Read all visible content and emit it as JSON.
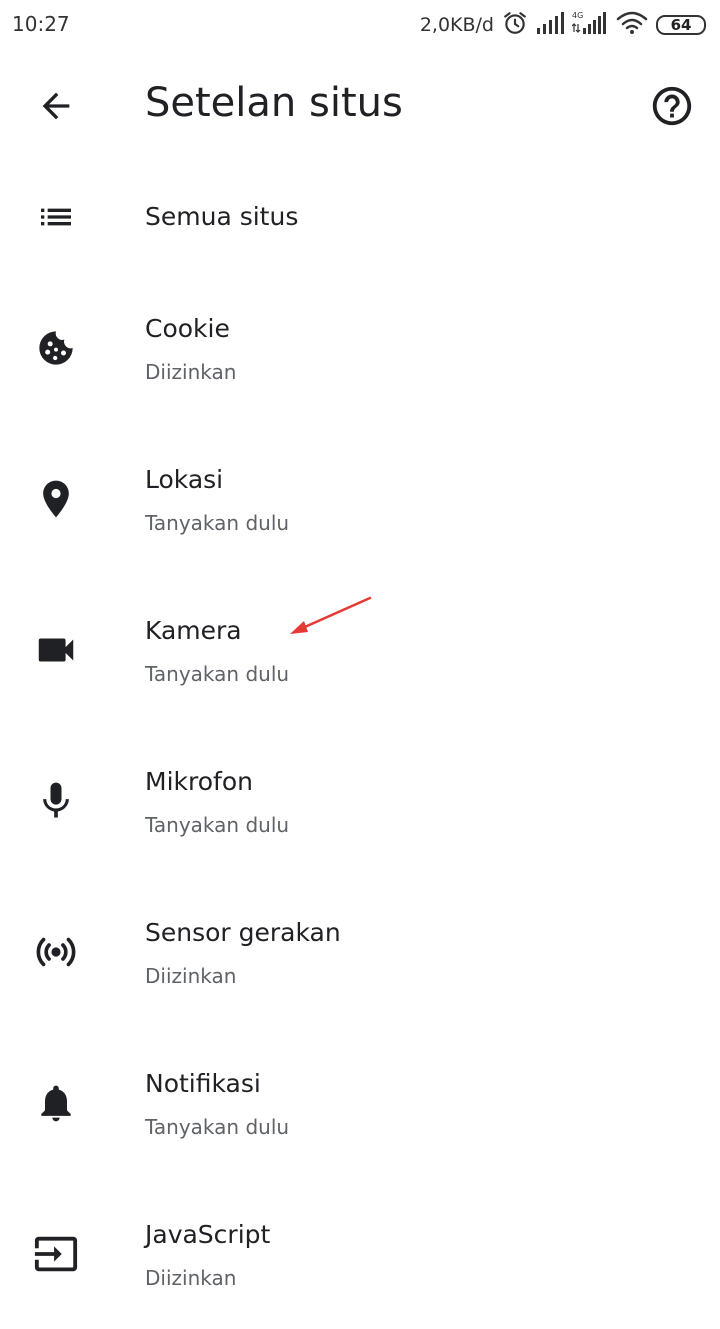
{
  "status_bar": {
    "time": "10:27",
    "net_speed": "2,0KB/d",
    "network_type": "4G",
    "battery_level": "64",
    "icons": [
      "alarm-icon",
      "signal-icon",
      "signal-4g-icon",
      "wifi-icon",
      "battery-icon"
    ]
  },
  "toolbar": {
    "title": "Setelan situs",
    "back_icon": "arrow-back-icon",
    "help_icon": "help-icon"
  },
  "items": [
    {
      "title": "Semua situs",
      "subtitle": "",
      "icon": "list-icon"
    },
    {
      "title": "Cookie",
      "subtitle": "Diizinkan",
      "icon": "cookie-icon"
    },
    {
      "title": "Lokasi",
      "subtitle": "Tanyakan dulu",
      "icon": "location-pin-icon"
    },
    {
      "title": "Kamera",
      "subtitle": "Tanyakan dulu",
      "icon": "videocam-icon"
    },
    {
      "title": "Mikrofon",
      "subtitle": "Tanyakan dulu",
      "icon": "microphone-icon"
    },
    {
      "title": "Sensor gerakan",
      "subtitle": "Diizinkan",
      "icon": "sensors-icon"
    },
    {
      "title": "Notifikasi",
      "subtitle": "Tanyakan dulu",
      "icon": "bell-icon"
    },
    {
      "title": "JavaScript",
      "subtitle": "Diizinkan",
      "icon": "input-icon"
    }
  ],
  "colors": {
    "text_primary": "#202124",
    "text_secondary": "#5f6368",
    "icon": "#202124",
    "annotation_arrow": "#e53935"
  }
}
